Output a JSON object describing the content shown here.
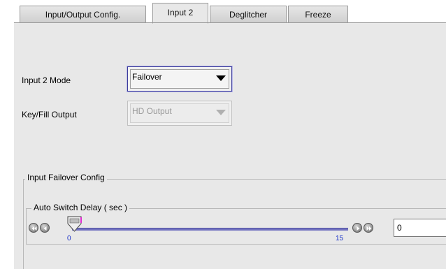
{
  "tabs": [
    {
      "label": "Input/Output Config.",
      "active": false
    },
    {
      "label": "Input 2",
      "active": true
    },
    {
      "label": "Deglitcher",
      "active": false
    },
    {
      "label": "Freeze",
      "active": false
    }
  ],
  "form": {
    "input2_mode": {
      "label": "Input 2 Mode",
      "value": "Failover",
      "enabled": true
    },
    "keyfill_output": {
      "label": "Key/Fill Output",
      "value": "HD Output",
      "enabled": false
    }
  },
  "failover_group": {
    "title": "Input Failover Config",
    "auto_switch": {
      "title": "Auto Switch Delay ( sec )",
      "min_label": "0",
      "max_label": "15",
      "min": 0,
      "max": 15,
      "value": 0,
      "field_value": "0"
    }
  },
  "colors": {
    "panel_bg": "#e8e8e8",
    "slider_track": "#7272c0",
    "tick_label": "#1a32c8",
    "thumb_marker": "#e02bd0"
  }
}
